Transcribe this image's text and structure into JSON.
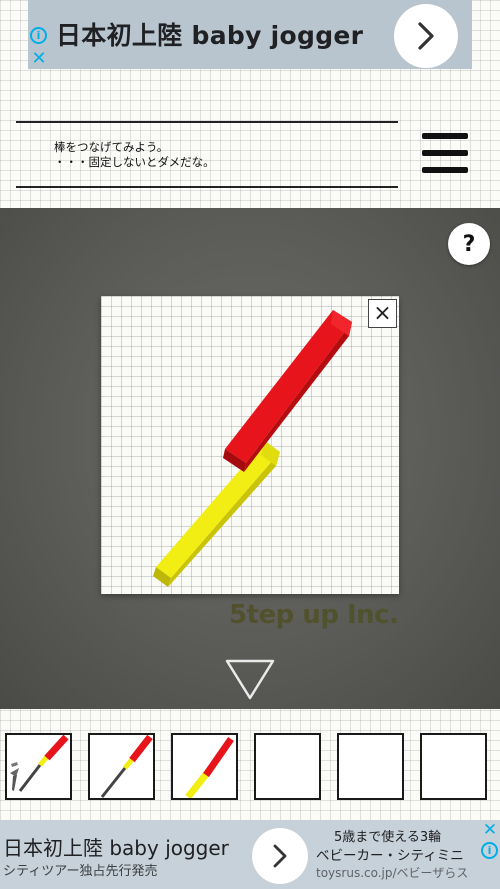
{
  "ad_top": {
    "headline": "日本初上陸 baby jogger",
    "info_glyph": "i",
    "close_glyph": "✕",
    "accent": "#00aee8"
  },
  "message": {
    "line1": "棒をつなげてみよう。",
    "line2": "・・・固定しないとダメだな。"
  },
  "stage": {
    "help_label": "?",
    "zoom_close_label": "×",
    "watermark": "5tep up Inc."
  },
  "inventory": {
    "slots": [
      {
        "item": "screw-and-rod"
      },
      {
        "item": "rod"
      },
      {
        "item": "red-yellow-rod"
      },
      {
        "item": "empty"
      },
      {
        "item": "empty"
      },
      {
        "item": "empty"
      }
    ]
  },
  "ad_bottom": {
    "title": "日本初上陸 baby jogger",
    "subtitle": "シティツアー独占先行発売",
    "right_line1": "5歳まで使える3輪",
    "right_line2": "ベビーカー・シティミニ",
    "right_line3": "toysrus.co.jp/ベビーザらス",
    "info_glyph": "i",
    "close_glyph": "✕"
  },
  "colors": {
    "red_rod": "#e8141b",
    "yellow_rod": "#f2ee14"
  }
}
